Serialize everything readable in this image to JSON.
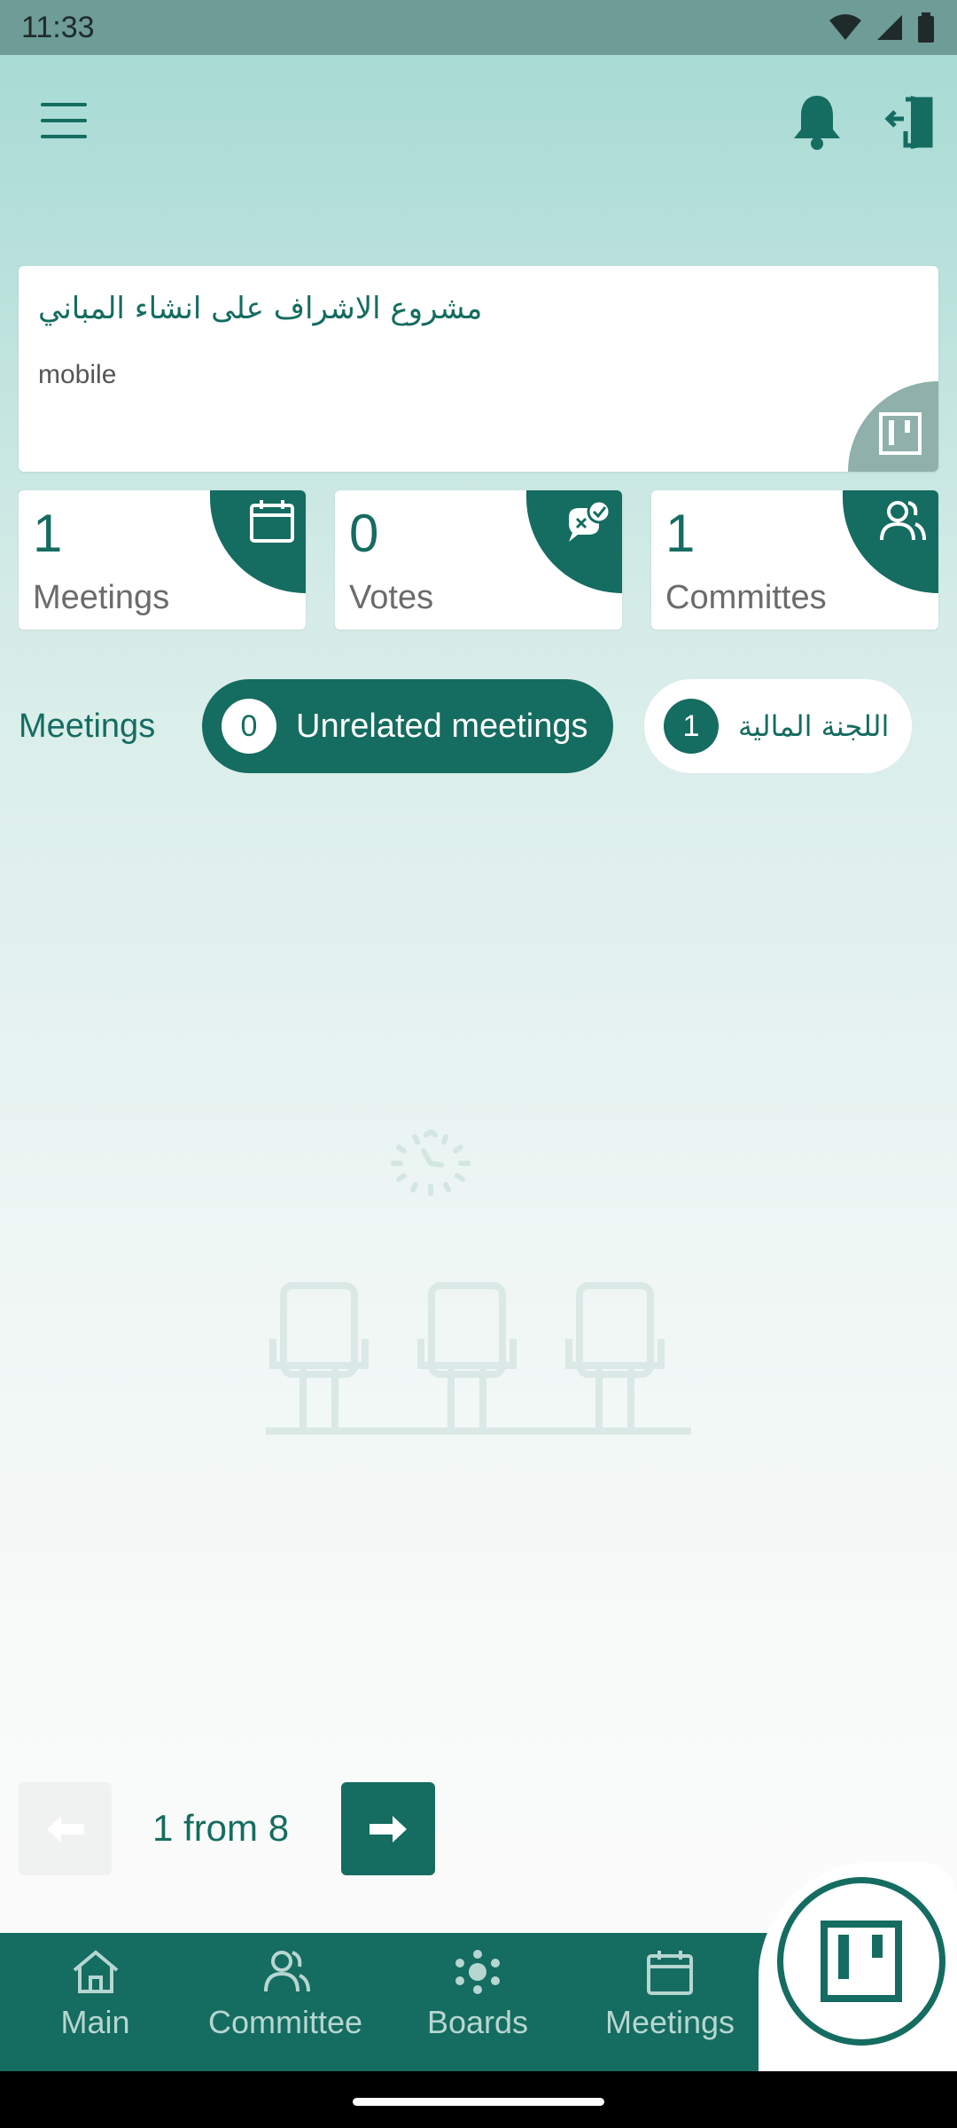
{
  "status_bar": {
    "time": "11:33"
  },
  "project": {
    "title": "مشروع الاشراف على انشاء المباني",
    "subtitle": "mobile"
  },
  "stats": [
    {
      "value": "1",
      "label": "Meetings",
      "icon": "calendar-icon"
    },
    {
      "value": "0",
      "label": "Votes",
      "icon": "vote-chat-icon"
    },
    {
      "value": "1",
      "label": "Committes",
      "icon": "people-icon"
    }
  ],
  "filters": {
    "label": "Meetings",
    "chips": [
      {
        "count": "0",
        "label": "Unrelated meetings",
        "active": true
      },
      {
        "count": "1",
        "label": "اللجنة المالية",
        "active": false
      }
    ]
  },
  "pager": {
    "text": "1 from 8"
  },
  "bottom_nav": [
    {
      "label": "Main",
      "icon": "home-icon"
    },
    {
      "label": "Committee",
      "icon": "committee-icon"
    },
    {
      "label": "Boards",
      "icon": "boards-icon"
    },
    {
      "label": "Meetings",
      "icon": "calendar-icon"
    }
  ],
  "colors": {
    "primary": "#156c60",
    "status_bar": "#6e9c97"
  }
}
